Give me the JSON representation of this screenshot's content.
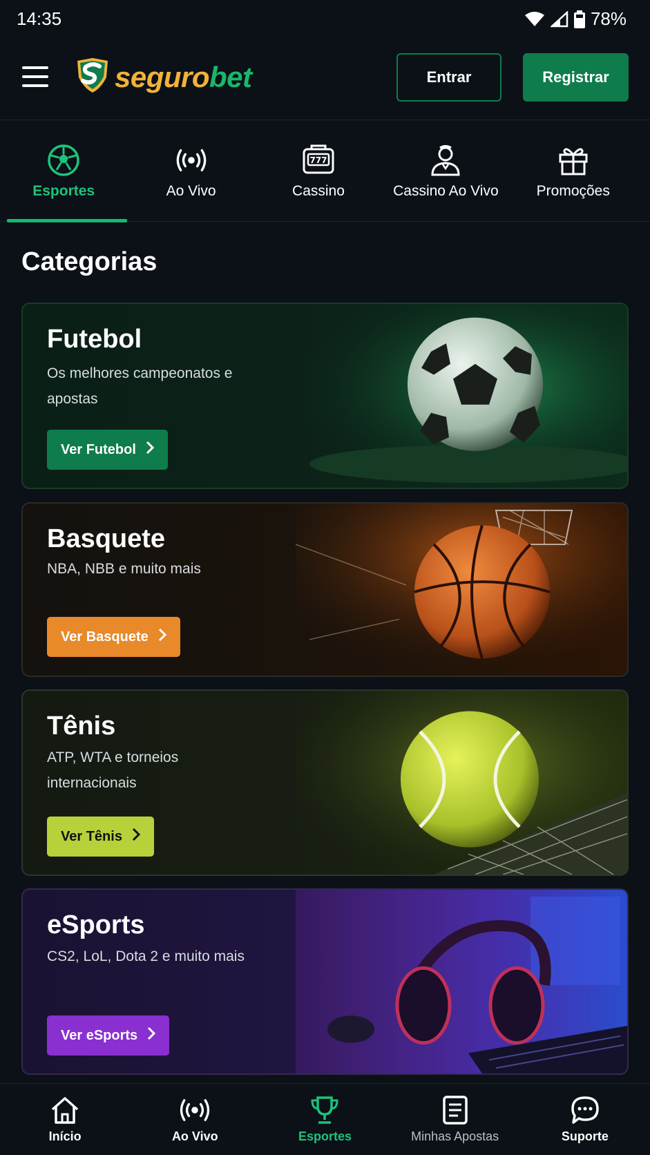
{
  "status_bar": {
    "time": "14:35",
    "battery": "78%"
  },
  "header": {
    "logo_text_1": "seguro",
    "logo_text_2": "bet",
    "login_label": "Entrar",
    "register_label": "Registrar"
  },
  "category_nav": {
    "items": [
      {
        "label": "Esportes",
        "icon": "soccer-ball-icon",
        "active": true
      },
      {
        "label": "Ao Vivo",
        "icon": "live-broadcast-icon",
        "active": false
      },
      {
        "label": "Cassino",
        "icon": "slot-machine-icon",
        "active": false
      },
      {
        "label": "Cassino Ao Vivo",
        "icon": "dealer-icon",
        "active": false
      },
      {
        "label": "Promoções",
        "icon": "gift-icon",
        "active": false
      }
    ]
  },
  "main": {
    "section_title": "Categorias",
    "cards": [
      {
        "title": "Futebol",
        "description": "Os melhores campeonatos e apostas",
        "cta": "Ver Futebol",
        "accent": "#0f7c4c"
      },
      {
        "title": "Basquete",
        "description": "NBA, NBB e muito mais",
        "cta": "Ver Basquete",
        "accent": "#e8892a"
      },
      {
        "title": "Tênis",
        "description": "ATP, WTA e torneios internacionais",
        "cta": "Ver Tênis",
        "accent": "#b6d13a"
      },
      {
        "title": "eSports",
        "description": "CS2, LoL, Dota 2 e muito mais",
        "cta": "Ver eSports",
        "accent": "#8a2fd0"
      }
    ]
  },
  "bottom_nav": {
    "items": [
      {
        "label": "Início",
        "icon": "home-icon"
      },
      {
        "label": "Ao Vivo",
        "icon": "live-broadcast-icon"
      },
      {
        "label": "Esportes",
        "icon": "trophy-icon",
        "active": true
      },
      {
        "label": "Minhas Apostas",
        "icon": "bet-slip-icon"
      },
      {
        "label": "Suporte",
        "icon": "chat-support-icon"
      }
    ]
  },
  "colors": {
    "background": "#0b1117",
    "brand_green": "#0f7c4c",
    "active_green": "#1ec27a",
    "logo_gold": "#f2b23a"
  }
}
